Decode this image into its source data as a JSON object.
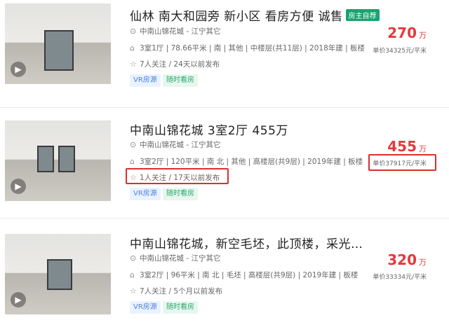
{
  "listings": [
    {
      "title": "仙林 南大和园旁 新小区 看房方便 诚售",
      "badge": "房主自荐",
      "location": "中南山锦花城 - 江宁其它",
      "details": "3室1厅 | 78.66平米 | 南 | 其他 | 中楼层(共11层) | 2018年建 | 板楼",
      "followers": "7人关注 / 24天以前发布",
      "tags": [
        "VR房源",
        "随时看房"
      ],
      "price": "270",
      "price_unit": "万",
      "unit_price": "单价34325元/平米"
    },
    {
      "title": "中南山锦花城 3室2厅 455万",
      "location": "中南山锦花城 - 江宁其它",
      "details": "3室2厅 | 120平米 | 南 北 | 其他 | 高楼层(共9层) | 2019年建 | 板楼",
      "followers": "1人关注 / 17天以前发布",
      "tags": [
        "VR房源",
        "随时看房"
      ],
      "price": "455",
      "price_unit": "万",
      "unit_price": "单价37917元/平米"
    },
    {
      "title": "中南山锦花城，新空毛坯，此顶楼，采光…",
      "location": "中南山锦花城 - 江宁其它",
      "details": "3室2厅 | 96平米 | 南 北 | 毛坯 | 高楼层(共9层) | 2019年建 | 板楼",
      "followers": "7人关注 / 5个月以前发布",
      "tags": [
        "VR房源",
        "随时看房"
      ],
      "price": "320",
      "price_unit": "万",
      "unit_price": "单价33334元/平米"
    }
  ],
  "icons": {
    "location": "location-pin-icon",
    "house": "house-icon",
    "star": "star-icon",
    "vr": "vr-play-icon"
  },
  "colors": {
    "price": "#e4393c",
    "badge": "#1aa36f",
    "vr_tag": "#4d82e0",
    "anytime_tag": "#2aa86d",
    "highlight": "#d9302b"
  }
}
